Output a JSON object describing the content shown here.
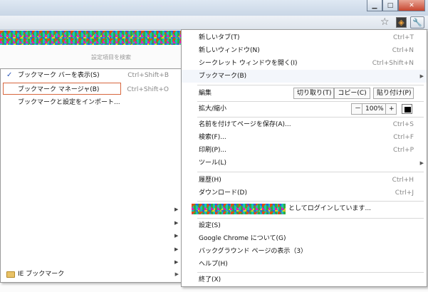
{
  "window": {
    "minimize_glyph": "▁",
    "maximize_glyph": "□",
    "close_glyph": "✕"
  },
  "toolbar": {
    "star_icon": "star-icon",
    "extension_icon": "extension-icon",
    "wrench_icon": "wrench-icon"
  },
  "page": {
    "settings_search": "設定項目を検索"
  },
  "main_menu": {
    "new_tab": {
      "label": "新しいタブ(T)",
      "shortcut": "Ctrl+T"
    },
    "new_window": {
      "label": "新しいウィンドウ(N)",
      "shortcut": "Ctrl+N"
    },
    "incognito": {
      "label": "シークレット ウィンドウを開く(I)",
      "shortcut": "Ctrl+Shift+N"
    },
    "bookmarks": {
      "label": "ブックマーク(B)"
    },
    "edit": {
      "label": "編集",
      "cut": "切り取り(T)",
      "copy": "コピー(C)",
      "paste": "貼り付け(P)"
    },
    "zoom": {
      "label": "拡大/縮小",
      "minus": "－",
      "value": "100%",
      "plus": "+"
    },
    "save_page": {
      "label": "名前を付けてページを保存(A)...",
      "shortcut": "Ctrl+S"
    },
    "find": {
      "label": "検索(F)...",
      "shortcut": "Ctrl+F"
    },
    "print": {
      "label": "印刷(P)...",
      "shortcut": "Ctrl+P"
    },
    "tools": {
      "label": "ツール(L)"
    },
    "history": {
      "label": "履歴(H)",
      "shortcut": "Ctrl+H"
    },
    "downloads": {
      "label": "ダウンロード(D)",
      "shortcut": "Ctrl+J"
    },
    "signed_in": {
      "label": "としてログインしています..."
    },
    "settings": {
      "label": "設定(S)"
    },
    "about": {
      "label": "Google Chrome について(G)"
    },
    "background_pages": {
      "label": "バックグラウンド ページの表示（3）"
    },
    "help": {
      "label": "ヘルプ(H)"
    },
    "exit": {
      "label": "終了(X)"
    }
  },
  "bookmark_menu": {
    "show_bar": {
      "label": "ブックマーク バーを表示(S)",
      "shortcut": "Ctrl+Shift+B",
      "checked": true
    },
    "manager": {
      "label": "ブックマーク マネージャ(B)",
      "shortcut": "Ctrl+Shift+O"
    },
    "import": {
      "label": "ブックマークと設定をインポート..."
    },
    "ie_bookmarks": {
      "label": "IE ブックマーク"
    }
  },
  "glyphs": {
    "check": "✓",
    "submenu_arrow": "▶"
  }
}
